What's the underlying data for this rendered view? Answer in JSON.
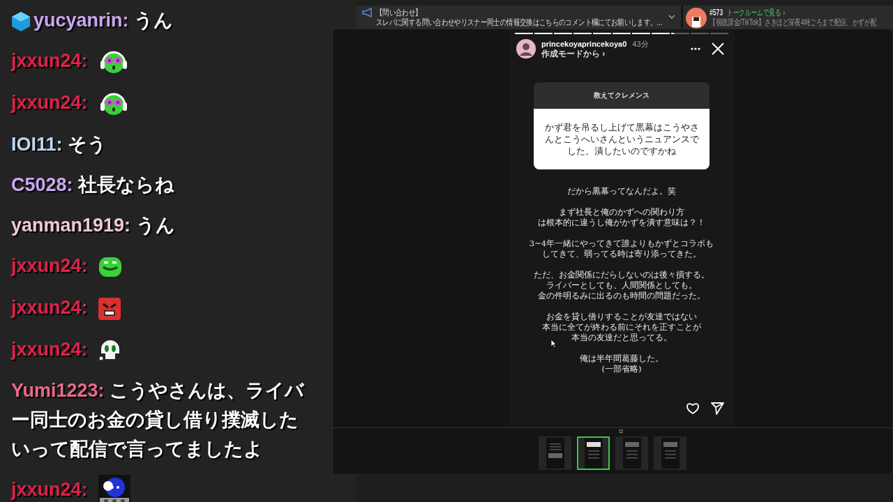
{
  "chat": [
    {
      "kind": "text",
      "badge": true,
      "user": "yucyanrin:",
      "color": "#c9a6f0",
      "lines": [
        "うん"
      ]
    },
    {
      "kind": "headphones",
      "badge": false,
      "user": "jxxun24:",
      "color": "#e0204a"
    },
    {
      "kind": "headphones",
      "badge": false,
      "user": "jxxun24:",
      "color": "#e0204a"
    },
    {
      "kind": "text",
      "badge": false,
      "user": "IOI11:",
      "color": "#bcd6f0",
      "lines": [
        "そう"
      ]
    },
    {
      "kind": "text",
      "badge": false,
      "user": "C5028:",
      "color": "#c9a6f0",
      "lines": [
        "社長ならね"
      ]
    },
    {
      "kind": "text",
      "badge": false,
      "user": "yanman1919:",
      "color": "#f0c8d4",
      "lines": [
        "うん"
      ]
    },
    {
      "kind": "frog",
      "badge": false,
      "user": "jxxun24:",
      "color": "#e0204a"
    },
    {
      "kind": "angry",
      "badge": false,
      "user": "jxxun24:",
      "color": "#e0204a"
    },
    {
      "kind": "skull",
      "badge": false,
      "user": "jxxun24:",
      "color": "#e0204a"
    },
    {
      "kind": "text",
      "badge": false,
      "user": "Yumi1223:",
      "color": "#e86a8c",
      "lines": [
        "こうやさんは、ライバ",
        "ー同士のお金の貸し借り撲滅した",
        "いって配信で言ってましたよ"
      ]
    },
    {
      "kind": "robot",
      "badge": false,
      "user": "jxxun24:",
      "color": "#e0204a"
    }
  ],
  "announcement": {
    "title": "【問い合わせ】",
    "text": "スレパに関する問い合わせやリスナー同士の情報交換はこちらのコメント欄にてお願いします。..."
  },
  "talk": {
    "number": "#573",
    "link": "トークルームで見る ›",
    "preview": "【視聴課金/TikTok】さきほど深夜4時ごろまで配信、かずが配"
  },
  "story": {
    "segments": [
      {
        "level": 1
      },
      {
        "level": 1
      },
      {
        "level": 1
      },
      {
        "level": 1
      },
      {
        "level": 1
      },
      {
        "level": 1
      },
      {
        "level": 1
      },
      {
        "level": 1
      },
      {
        "level": 0.15
      },
      {
        "level": 0
      },
      {
        "level": 0
      }
    ],
    "username": "princekoyaprincekoya0",
    "time": "43分",
    "source": "作成モードから ›",
    "question": {
      "title": "教えてクレメンス",
      "text": "かず君を吊るし上げて黒幕はこうやさんとこうへいさんというニュアンスでした。潰したいのですかね"
    },
    "paragraphs": [
      [
        "だから黒幕ってなんだよ。笑"
      ],
      [
        "まず社長と俺のかずへの関わり方",
        "は根本的に違うし俺がかずを潰す意味は？！"
      ],
      [
        "3~4年一緒にやってきて誰よりもかずとコラボも",
        "してきて、弱ってる時は寄り添ってきた。"
      ],
      [
        "ただ、お金関係にだらしないのは後々損する。",
        "ライバーとしても、人間関係としても。",
        "金の件明るみに出るのも時間の問題だった。"
      ],
      [
        "お金を貸し借りすることが友達ではない",
        "本当に全てが終わる前にそれを正すことが",
        "本当の友達だと思ってる。"
      ],
      [
        "俺は半年間葛藤した。",
        "(一部省略)"
      ]
    ]
  },
  "thumbnails": [
    {
      "selected": false
    },
    {
      "selected": true
    },
    {
      "selected": false
    },
    {
      "selected": false
    }
  ]
}
